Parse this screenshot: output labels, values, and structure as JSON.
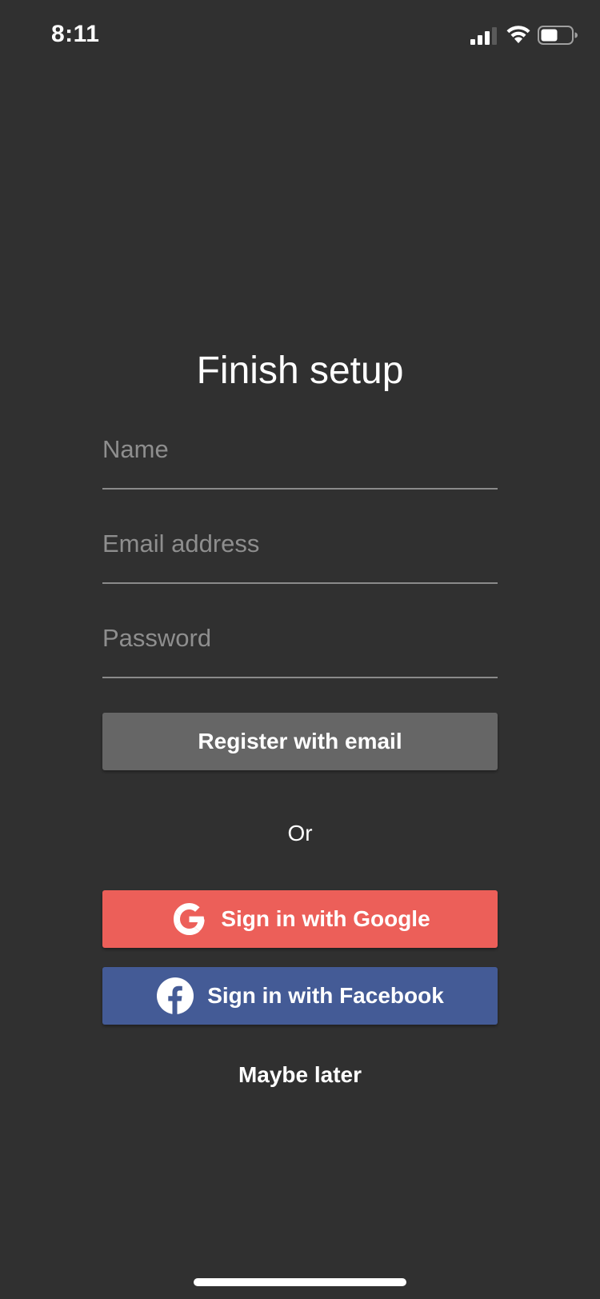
{
  "status_bar": {
    "time": "8:11",
    "signal_icon": "cellular-signal-icon",
    "wifi_icon": "wifi-icon",
    "battery_icon": "battery-icon",
    "battery_level": 0.55
  },
  "screen": {
    "title": "Finish setup",
    "fields": {
      "name": {
        "placeholder": "Name",
        "value": ""
      },
      "email": {
        "placeholder": "Email address",
        "value": ""
      },
      "password": {
        "placeholder": "Password",
        "value": ""
      }
    },
    "register_label": "Register with email",
    "or_label": "Or",
    "google": {
      "label": "Sign in with Google",
      "icon": "google-icon",
      "color": "#ec5f59"
    },
    "facebook": {
      "label": "Sign in with Facebook",
      "icon": "facebook-icon",
      "color": "#445b96"
    },
    "maybe_later_label": "Maybe later"
  },
  "colors": {
    "background": "#303030",
    "register_button": "#666666"
  }
}
